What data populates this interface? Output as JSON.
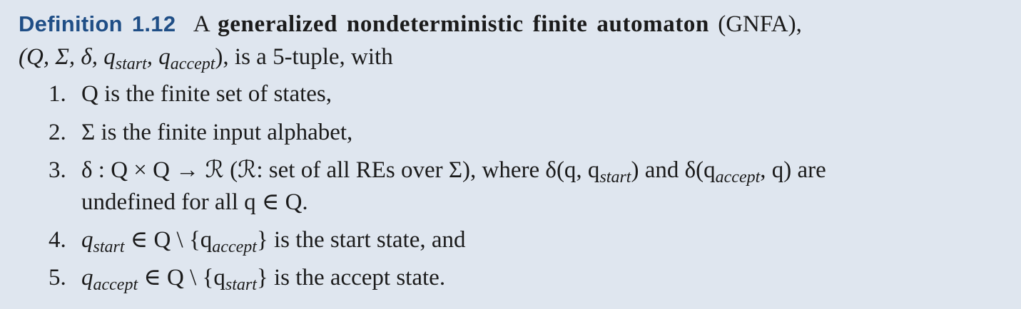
{
  "definition": {
    "label": "Definition 1.12",
    "intro_a": "A",
    "term": "generalized nondeterministic finite automaton",
    "abbrev": "(GNFA),",
    "tuple_text": "(Q, Σ, δ, q",
    "tuple_sub1": "start",
    "tuple_mid": ", q",
    "tuple_sub2": "accept",
    "tuple_end": "), is a 5-tuple, with"
  },
  "items": [
    {
      "number": "1.",
      "text": "Q is the finite set of states,"
    },
    {
      "number": "2.",
      "text": "Σ is the finite input alphabet,"
    },
    {
      "number": "3.",
      "line1_a": "δ : Q × Q → ℛ (ℛ: set of all REs over Σ), where δ(q, q",
      "line1_sub1": "start",
      "line1_b": ") and δ(q",
      "line1_sub2": "accept",
      "line1_c": ", q) are",
      "line2": "undefined for all q ∈ Q."
    },
    {
      "number": "4.",
      "a": "q",
      "sub1": "start",
      "b": " ∈ Q \\ {q",
      "sub2": "accept",
      "c": "} is the start state, and"
    },
    {
      "number": "5.",
      "a": "q",
      "sub1": "accept",
      "b": " ∈ Q \\ {q",
      "sub2": "start",
      "c": "} is the accept state."
    }
  ]
}
